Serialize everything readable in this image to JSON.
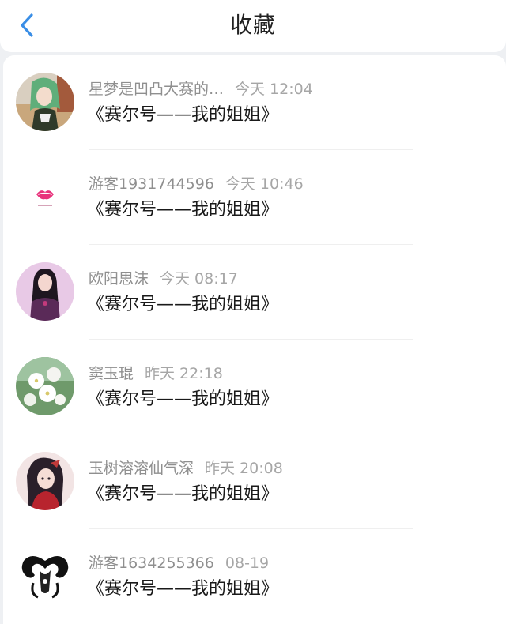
{
  "header": {
    "title": "收藏",
    "back_icon": "chevron-left-icon",
    "accent_color": "#3a8ee6"
  },
  "items": [
    {
      "user": "星梦是凹凸大赛的…",
      "time": "今天 12:04",
      "title": "《赛尔号——我的姐姐》",
      "avatar": "anime-girl-green-hair"
    },
    {
      "user": "游客1931744596",
      "time": "今天 10:46",
      "title": "《赛尔号——我的姐姐》",
      "avatar": "pink-lips-logo"
    },
    {
      "user": "欧阳思沫",
      "time": "今天 08:17",
      "title": "《赛尔号——我的姐姐》",
      "avatar": "girl-portrait-purple"
    },
    {
      "user": "窦玉琨",
      "time": "昨天 22:18",
      "title": "《赛尔号——我的姐姐》",
      "avatar": "white-flowers"
    },
    {
      "user": "玉树溶溶仙气深",
      "time": "昨天 20:08",
      "title": "《赛尔号——我的姐姐》",
      "avatar": "anime-character-red"
    },
    {
      "user": "游客1634255366",
      "time": "08-19",
      "title": "《赛尔号——我的姐姐》",
      "avatar": "aries-symbol-black"
    }
  ]
}
